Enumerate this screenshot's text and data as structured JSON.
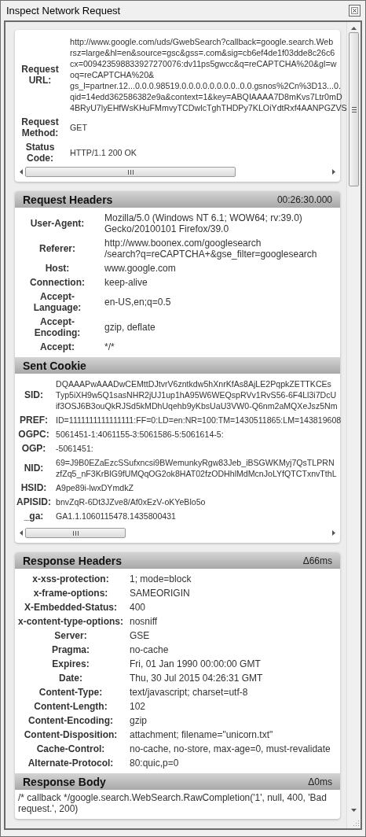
{
  "window": {
    "title": "Inspect Network Request"
  },
  "cards": [
    {
      "horizontal_scrollbar": true,
      "sections": [
        {
          "kind": "summary",
          "fields": [
            {
              "label": "Request\nURL:",
              "lines": [
                "http://www.google.com/uds/GwebSearch?callback=google.search.Web",
                "rsz=large&hl=en&source=gsc&gss=.com&sig=cb6ef4de1f03dde8c26c6",
                "cx=009423598833927270076:dv11ps5gwcc&q=reCAPTCHA%20&gl=w",
                "oq=reCAPTCHA%20&",
                "gs_l=partner.12...0.0.0.98519.0.0.0.0.0.0.0.0..0.0.gsnos%2Cn%3D13...0.",
                "qid=14edd362586382e9a&context=1&key=ABQIAAAA7D8mKvs7Ltr0mD",
                "4BRyU7lyEHfWsKHuFMmvyTCDwlcTghTHDPy7KLOiYdtRxf4AANPGZVS"
              ]
            },
            {
              "label": "Request\nMethod:",
              "lines": [
                "GET"
              ]
            },
            {
              "label": "Status\nCode:",
              "lines": [
                "HTTP/1.1 200 OK"
              ]
            }
          ]
        }
      ]
    },
    {
      "horizontal_scrollbar": true,
      "sections": [
        {
          "kind": "request",
          "title": "Request Headers",
          "timing": "00:26:30.000",
          "fields": [
            {
              "label": "User-Agent:",
              "lines": [
                "Mozilla/5.0 (Windows NT 6.1; WOW64; rv:39.0)",
                "Gecko/20100101 Firefox/39.0"
              ]
            },
            {
              "label": "Referer:",
              "lines": [
                "http://www.boonex.com/googlesearch",
                "/search?q=reCAPTCHA+&gse_filter=googlesearch"
              ]
            },
            {
              "label": "Host:",
              "lines": [
                "www.google.com"
              ]
            },
            {
              "label": "Connection:",
              "lines": [
                "keep-alive"
              ]
            },
            {
              "label": "Accept-Language:",
              "lines": [
                "en-US,en;q=0.5"
              ]
            },
            {
              "label": "Accept-Encoding:",
              "lines": [
                "gzip, deflate"
              ]
            },
            {
              "label": "Accept:",
              "lines": [
                "*/*"
              ]
            }
          ]
        },
        {
          "kind": "cookies",
          "title": "Sent Cookie",
          "fields": [
            {
              "label": "SID:",
              "lines": [
                "DQAAAPwAAADwCEMttDJtvrV6zntkdw5hXnrKfAs8AjLE2PqpkZETTKCEs",
                "Typ5iXH9w5Q1sasNHR2jUJ1up1hA95W6WEQspRVv1RvS56-6F4Ll3i7DcU",
                "if3OSJ6B3ouQkRJSd5kMDhUqehb9yKbsUaU3VW0-Q6nm2aMQXeJsz5Nm"
              ]
            },
            {
              "label": "PREF:",
              "lines": [
                "ID=1111111111111111:FF=0:LD=en:NR=100:TM=1430511865:LM=143819608"
              ]
            },
            {
              "label": "OGPC:",
              "lines": [
                "5061451-1:4061155-3:5061586-5:5061614-5:"
              ]
            },
            {
              "label": "OGP:",
              "lines": [
                "-5061451:"
              ]
            },
            {
              "label": "NID:",
              "lines": [
                "69=J9B0EZaEzcSSufxncsi9BWemunkyRgw83Jeb_iBSGWKMyj7QsTLPRN",
                "zfZq5_nF3KrBlG9fUMQqOG2ok8HAT02fzODHhlMdMcnJoLYfQTCTxnvTthL"
              ]
            },
            {
              "label": "HSID:",
              "lines": [
                "A9pe89i-lwxDYmdkZ"
              ]
            },
            {
              "label": "APISID:",
              "lines": [
                "bnvZqR-6Dt3JZve8/Af0xEzV-oKYeBlo5o"
              ]
            },
            {
              "label": "_ga:",
              "lines": [
                "GA1.1.1060115478.1435800431"
              ]
            }
          ]
        }
      ]
    },
    {
      "horizontal_scrollbar": false,
      "sections": [
        {
          "kind": "response",
          "title": "Response Headers",
          "timing": "Δ66ms",
          "fields": [
            {
              "label": "x-xss-protection:",
              "lines": [
                "1; mode=block"
              ]
            },
            {
              "label": "x-frame-options:",
              "lines": [
                "SAMEORIGIN"
              ]
            },
            {
              "label": "X-Embedded-Status:",
              "lines": [
                "400"
              ]
            },
            {
              "label": "x-content-type-options:",
              "lines": [
                "nosniff"
              ]
            },
            {
              "label": "Server:",
              "lines": [
                "GSE"
              ]
            },
            {
              "label": "Pragma:",
              "lines": [
                "no-cache"
              ]
            },
            {
              "label": "Expires:",
              "lines": [
                "Fri, 01 Jan 1990 00:00:00 GMT"
              ]
            },
            {
              "label": "Date:",
              "lines": [
                "Thu, 30 Jul 2015 04:26:31 GMT"
              ]
            },
            {
              "label": "Content-Type:",
              "lines": [
                "text/javascript; charset=utf-8"
              ]
            },
            {
              "label": "Content-Length:",
              "lines": [
                "102"
              ]
            },
            {
              "label": "Content-Encoding:",
              "lines": [
                "gzip"
              ]
            },
            {
              "label": "Content-Disposition:",
              "lines": [
                "attachment; filename=\"unicorn.txt\""
              ]
            },
            {
              "label": "Cache-Control:",
              "lines": [
                "no-cache, no-store, max-age=0, must-revalidate"
              ]
            },
            {
              "label": "Alternate-Protocol:",
              "lines": [
                "80:quic,p=0"
              ]
            }
          ]
        },
        {
          "kind": "body",
          "title": "Response Body",
          "timing": "Δ0ms",
          "text": "/* callback */google.search.WebSearch.RawCompletion('1', null, 400, 'Bad request.', 200)"
        }
      ]
    }
  ]
}
